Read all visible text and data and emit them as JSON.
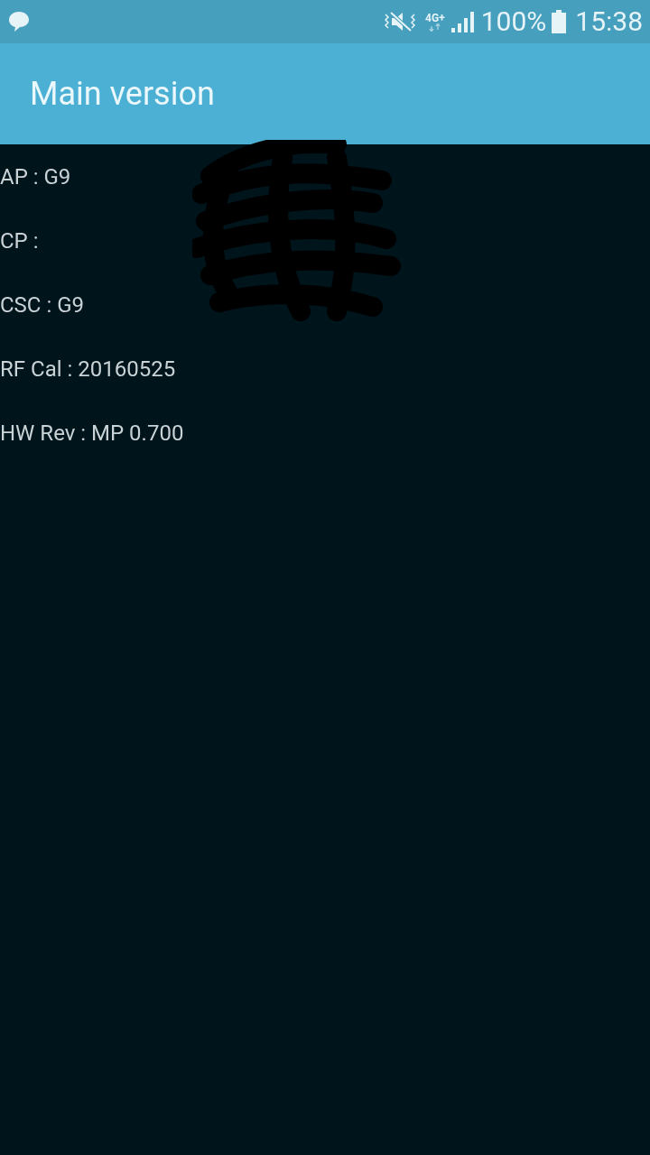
{
  "status_bar": {
    "battery": "100%",
    "time": "15:38",
    "network": "4G+"
  },
  "app_bar": {
    "title": "Main version"
  },
  "rows": [
    {
      "text": "AP : G9"
    },
    {
      "text": "CP :"
    },
    {
      "text": "CSC : G9"
    },
    {
      "text": "RF Cal : 20160525"
    },
    {
      "text": "HW Rev : MP 0.700"
    }
  ]
}
